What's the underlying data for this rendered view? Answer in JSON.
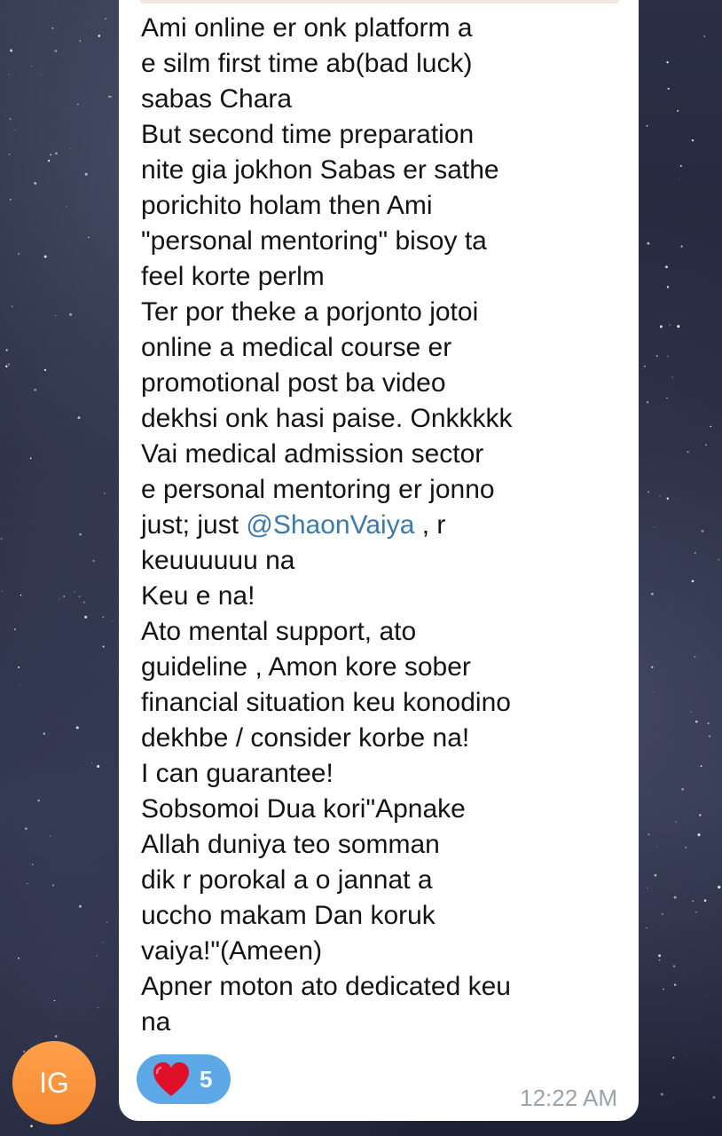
{
  "avatar": {
    "initials": "IG",
    "color": "#f5913c"
  },
  "message": {
    "lines_before_mention": "Ami online er onk platform a\ne silm first time ab(bad luck)\nsabas Chara\nBut second time preparation\nnite gia jokhon Sabas er sathe\nporichito holam then Ami\n\"personal mentoring\" bisoy ta\nfeel korte perlm\nTer por theke a porjonto jotoi\nonline a medical course er\npromotional post ba video\ndekhsi onk hasi paise. Onkkkkk\nVai medical admission sector\ne personal mentoring er jonno\njust; just ",
    "mention": "@ShaonVaiya",
    "lines_after_mention": " , r\nkeuuuuuu na\nKeu e na!\nAto mental support, ato\nguideline , Amon kore sober\nfinancial situation keu konodino\ndekhbe / consider korbe na!\nI can guarantee!\nSobsomoi Dua kori\"Apnake\nAllah duniya teo somman\ndik r porokal a o jannat a\nuccho makam Dan koruk\nvaiya!\"(Ameen)\nApner moton ato dedicated keu\nna",
    "reaction": {
      "emoji": "heart-icon",
      "count": "5",
      "color": "#5da9e8"
    },
    "time": "12:22 AM"
  },
  "colors": {
    "mention": "#3a79b0",
    "bubble": "#ffffff",
    "timestamp": "#9aa3ab"
  }
}
